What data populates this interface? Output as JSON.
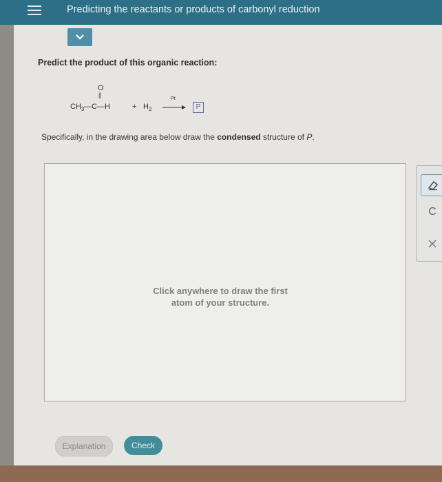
{
  "header": {
    "title": "Predicting the reactants or products of carbonyl reduction",
    "menu_icon": "hamburger-menu-icon",
    "colors": {
      "bar": "#2d6f86",
      "accent_button": "#4f8fa7"
    }
  },
  "question": {
    "prompt": "Predict the product of this organic reaction:",
    "reaction": {
      "oxygen": "O",
      "double_bond": "||",
      "ch3": "CH",
      "ch3_sub": "3",
      "chain": "—C—H",
      "plus": "+",
      "h2": "H",
      "h2_sub": "2",
      "catalyst": "Pt",
      "product": "P"
    },
    "instruction": {
      "prefix": "Specifically, in the drawing area below draw the ",
      "bold": "condensed",
      "middle": " structure of ",
      "italic": "P",
      "suffix": "."
    }
  },
  "drawing_area": {
    "hint_line1": "Click anywhere to draw the first",
    "hint_line2": "atom of your structure."
  },
  "tools": {
    "eraser_icon": "eraser-icon",
    "c_label": "C",
    "close_icon": "close-icon"
  },
  "footer": {
    "explanation_label": "Explanation",
    "check_label": "Check",
    "check_color": "#3f8e99"
  }
}
